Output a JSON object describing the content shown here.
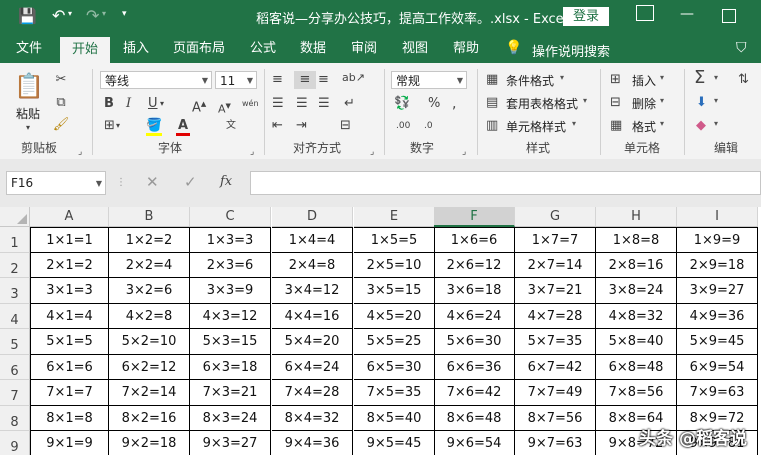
{
  "window": {
    "title": "稻客说—分享办公技巧，提高工作效率。.xlsx  -  Excel",
    "login_label": "登录"
  },
  "tabs": [
    "文件",
    "开始",
    "插入",
    "页面布局",
    "公式",
    "数据",
    "审阅",
    "视图",
    "帮助"
  ],
  "tell_me": "操作说明搜索",
  "ribbon": {
    "clipboard": {
      "paste": "粘贴",
      "label": "剪贴板"
    },
    "font": {
      "name": "等线",
      "size": "11",
      "label": "字体",
      "pinyin": "wén"
    },
    "alignment": {
      "label": "对齐方式"
    },
    "number": {
      "format": "常规",
      "label": "数字"
    },
    "styles": {
      "conditional": "条件格式",
      "table": "套用表格格式",
      "cell": "单元格样式",
      "label": "样式"
    },
    "cells": {
      "insert": "插入",
      "delete": "删除",
      "format": "格式",
      "label": "单元格"
    },
    "editing": {
      "label": "编辑"
    }
  },
  "formula_bar": {
    "name_box": "F16",
    "fx": "fx",
    "value": ""
  },
  "sheet": {
    "columns": [
      "A",
      "B",
      "C",
      "D",
      "E",
      "F",
      "G",
      "H",
      "I"
    ],
    "selected_column": "F",
    "rows": [
      [
        "1×1=1",
        "1×2=2",
        "1×3=3",
        "1×4=4",
        "1×5=5",
        "1×6=6",
        "1×7=7",
        "1×8=8",
        "1×9=9"
      ],
      [
        "2×1=2",
        "2×2=4",
        "2×3=6",
        "2×4=8",
        "2×5=10",
        "2×6=12",
        "2×7=14",
        "2×8=16",
        "2×9=18"
      ],
      [
        "3×1=3",
        "3×2=6",
        "3×3=9",
        "3×4=12",
        "3×5=15",
        "3×6=18",
        "3×7=21",
        "3×8=24",
        "3×9=27"
      ],
      [
        "4×1=4",
        "4×2=8",
        "4×3=12",
        "4×4=16",
        "4×5=20",
        "4×6=24",
        "4×7=28",
        "4×8=32",
        "4×9=36"
      ],
      [
        "5×1=5",
        "5×2=10",
        "5×3=15",
        "5×4=20",
        "5×5=25",
        "5×6=30",
        "5×7=35",
        "5×8=40",
        "5×9=45"
      ],
      [
        "6×1=6",
        "6×2=12",
        "6×3=18",
        "6×4=24",
        "6×5=30",
        "6×6=36",
        "6×7=42",
        "6×8=48",
        "6×9=54"
      ],
      [
        "7×1=7",
        "7×2=14",
        "7×3=21",
        "7×4=28",
        "7×5=35",
        "7×6=42",
        "7×7=49",
        "7×8=56",
        "7×9=63"
      ],
      [
        "8×1=8",
        "8×2=16",
        "8×3=24",
        "8×4=32",
        "8×5=40",
        "8×6=48",
        "8×7=56",
        "8×8=64",
        "8×9=72"
      ],
      [
        "9×1=9",
        "9×2=18",
        "9×3=27",
        "9×4=36",
        "9×5=45",
        "9×6=54",
        "9×7=63",
        "9×8=72",
        "9×9=81"
      ]
    ]
  },
  "watermark": "头条 @稻客说",
  "colors": {
    "accent": "#217346",
    "ribbon_bg": "#f3f3f3"
  }
}
